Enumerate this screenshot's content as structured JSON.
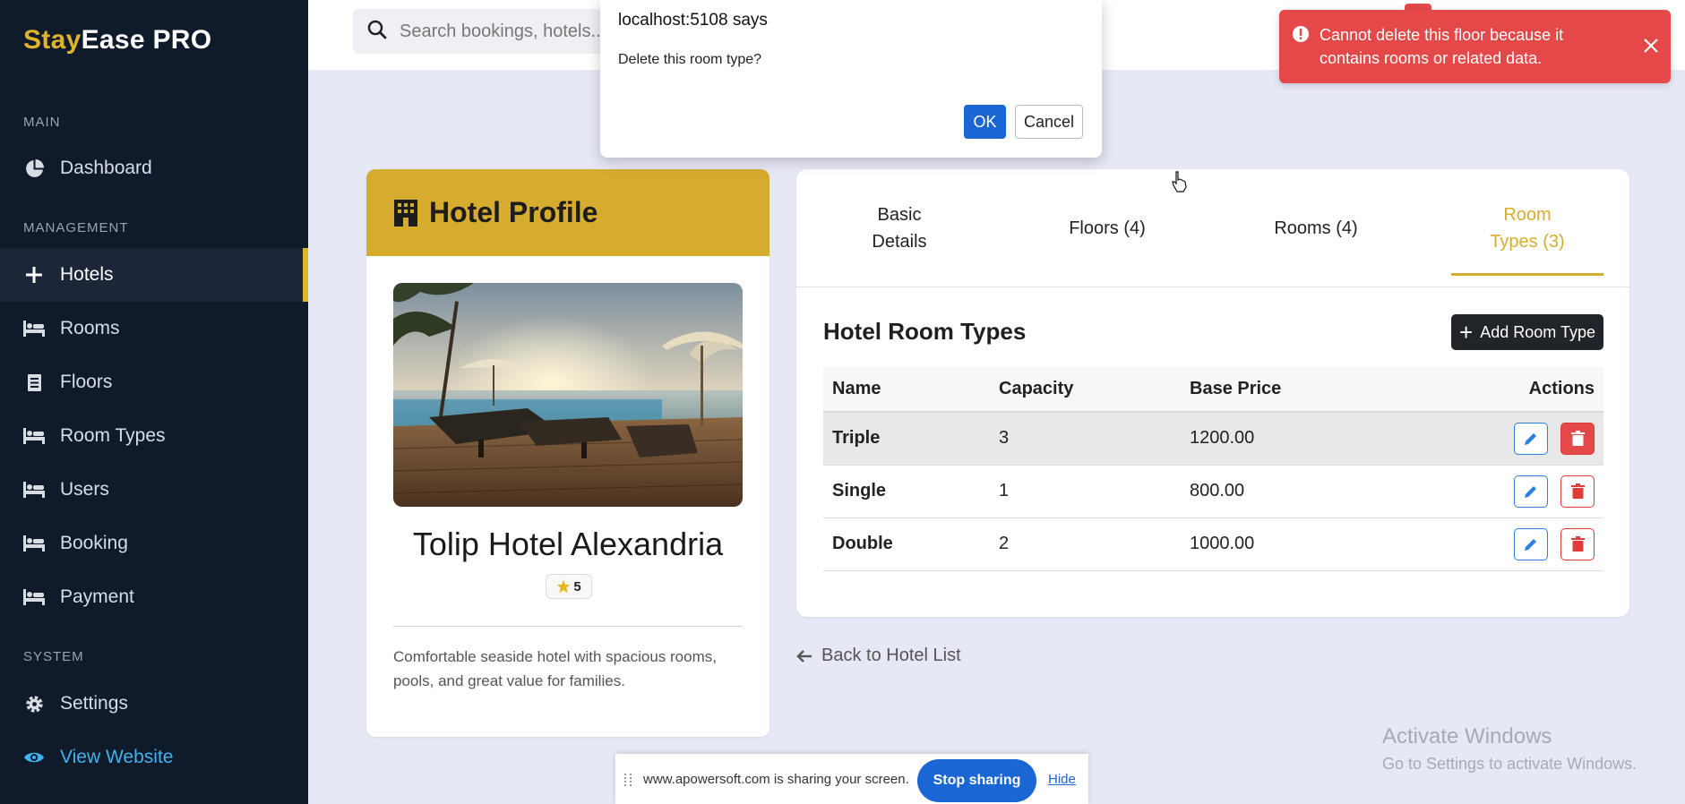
{
  "brand": {
    "part1": "Stay",
    "part2": "Ease PRO"
  },
  "sidebar": {
    "sections": {
      "main": "MAIN",
      "management": "MANAGEMENT",
      "system": "SYSTEM"
    },
    "items": [
      {
        "label": "Dashboard",
        "icon": "pie-chart-icon"
      },
      {
        "label": "Hotels",
        "icon": "plus-icon",
        "active": true
      },
      {
        "label": "Rooms",
        "icon": "bed-icon"
      },
      {
        "label": "Floors",
        "icon": "document-icon"
      },
      {
        "label": "Room Types",
        "icon": "bed-icon"
      },
      {
        "label": "Users",
        "icon": "bed-icon"
      },
      {
        "label": "Booking",
        "icon": "bed-icon"
      },
      {
        "label": "Payment",
        "icon": "bed-icon"
      },
      {
        "label": "Settings",
        "icon": "gear-icon"
      },
      {
        "label": "View Website",
        "icon": "eye-icon"
      }
    ]
  },
  "search": {
    "placeholder": "Search bookings, hotels..."
  },
  "dialog": {
    "origin": "localhost:5108 says",
    "message": "Delete this room type?",
    "ok": "OK",
    "cancel": "Cancel"
  },
  "toast": {
    "message": "Cannot delete this floor because it contains rooms or related data."
  },
  "profile": {
    "header": "Hotel Profile",
    "name": "Tolip Hotel Alexandria",
    "rating": "5",
    "description": "Comfortable seaside hotel with spacious rooms, pools, and great value for families."
  },
  "tabs": [
    {
      "label": "Basic\nDetails"
    },
    {
      "label": "Floors (4)"
    },
    {
      "label": "Rooms (4)"
    },
    {
      "label": "Room\nTypes (3)",
      "active": true
    }
  ],
  "room_types": {
    "title": "Hotel Room Types",
    "add_label": "Add Room Type",
    "columns": [
      "Name",
      "Capacity",
      "Base Price",
      "Actions"
    ],
    "rows": [
      {
        "name": "Triple",
        "capacity": "3",
        "price": "1200.00"
      },
      {
        "name": "Single",
        "capacity": "1",
        "price": "800.00"
      },
      {
        "name": "Double",
        "capacity": "2",
        "price": "1000.00"
      }
    ]
  },
  "back_link": "Back to Hotel List",
  "share_bar": {
    "text": "www.apowersoft.com is sharing your screen.",
    "stop": "Stop sharing",
    "hide": "Hide"
  },
  "watermark": {
    "line1": "Activate Windows",
    "line2": "Go to Settings to activate Windows."
  },
  "colors": {
    "accent": "#d6ac2f",
    "sidebar": "#0f1a2b",
    "danger": "#e54848",
    "primary": "#1a66d2"
  }
}
